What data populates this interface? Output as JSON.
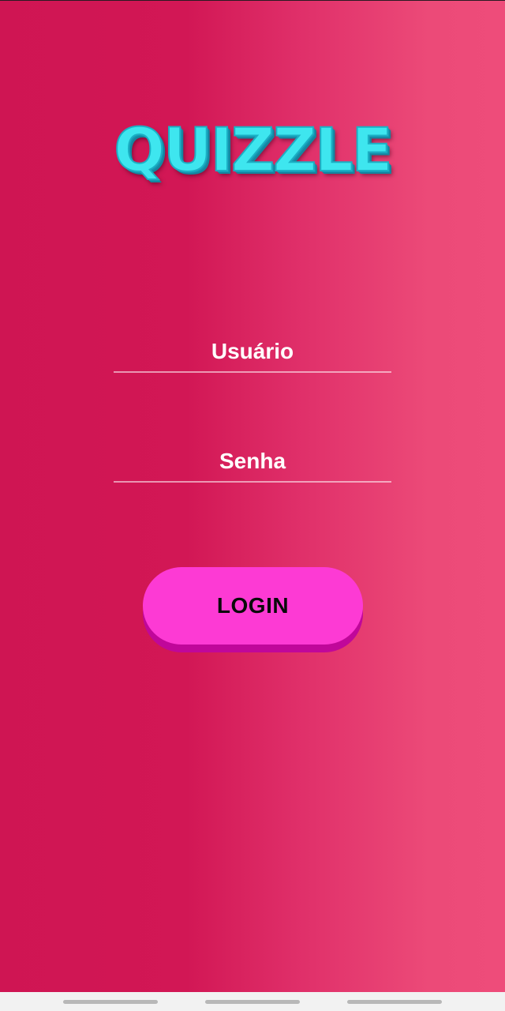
{
  "app": {
    "logo_text": "QUIZZLE"
  },
  "form": {
    "username_placeholder": "Usuário",
    "password_placeholder": "Senha",
    "login_label": "LOGIN"
  },
  "colors": {
    "background_left": "#cf1553",
    "background_right": "#ee4c7a",
    "logo_fill": "#3ee6ef",
    "button_fill": "#fd3ad4",
    "button_shadow": "#c0079a",
    "nav_bar": "#f2f2f2"
  },
  "nav": {
    "pills": [
      "nav-pill-left",
      "nav-pill-center",
      "nav-pill-right"
    ]
  }
}
